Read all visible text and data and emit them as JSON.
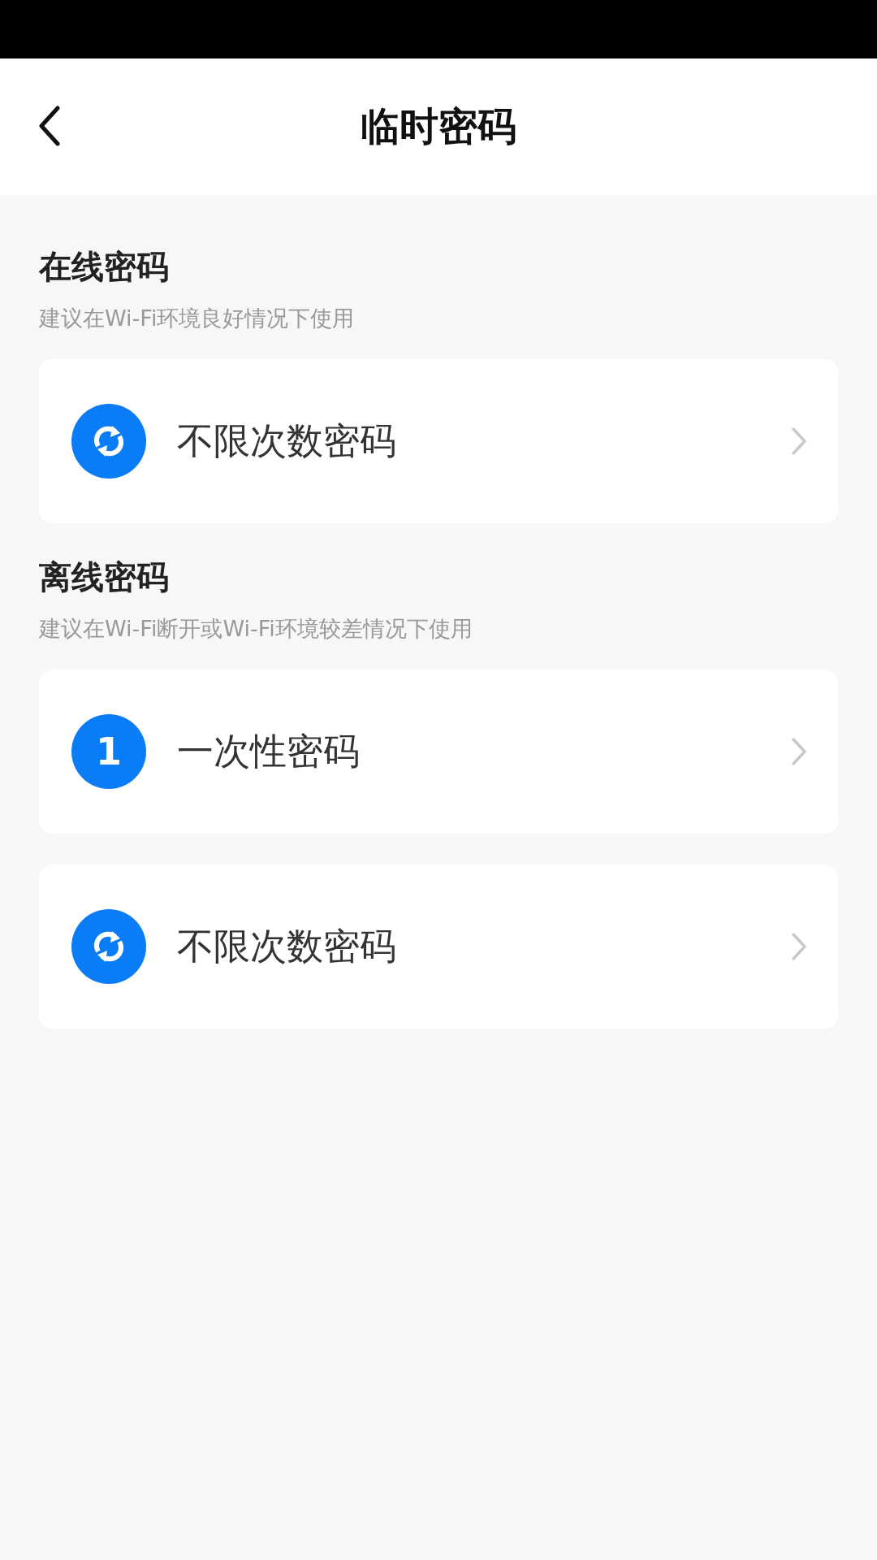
{
  "header": {
    "title": "临时密码"
  },
  "sections": [
    {
      "title": "在线密码",
      "subtitle": "建议在Wi-Fi环境良好情况下使用",
      "items": [
        {
          "kind": "unlimited",
          "label": "不限次数密码"
        }
      ]
    },
    {
      "title": "离线密码",
      "subtitle": "建议在Wi-Fi断开或Wi-Fi环境较差情况下使用",
      "items": [
        {
          "kind": "once",
          "badge": "1",
          "label": "一次性密码"
        },
        {
          "kind": "unlimited",
          "label": "不限次数密码"
        }
      ]
    }
  ]
}
